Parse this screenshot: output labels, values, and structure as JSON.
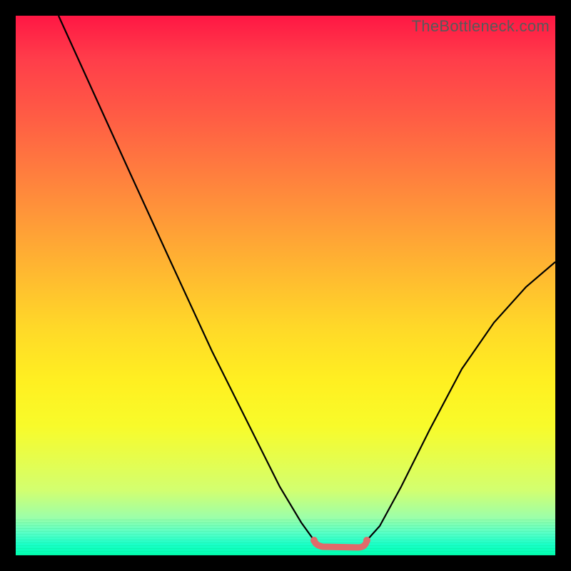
{
  "watermark": "TheBottleneck.com",
  "chart_data": {
    "type": "line",
    "title": "",
    "xlabel": "",
    "ylabel": "",
    "xlim": [
      0,
      100
    ],
    "ylim": [
      0,
      100
    ],
    "x": [
      8,
      15,
      22,
      30,
      38,
      45,
      50,
      54,
      57,
      60,
      63,
      66,
      72,
      78,
      85,
      92,
      100
    ],
    "y": [
      100,
      85,
      70,
      55,
      40,
      25,
      12,
      4,
      0,
      0,
      0,
      4,
      15,
      28,
      40,
      50,
      58
    ],
    "annotations": [],
    "legend": [],
    "notes": "Bottleneck-style V-curve over rainbow heat gradient; flat minimum segment highlighted in coral."
  },
  "curve": {
    "stroke": "#000000",
    "stroke_width": 2.2,
    "highlight_stroke": "#e06a6a",
    "highlight_width": 9
  }
}
